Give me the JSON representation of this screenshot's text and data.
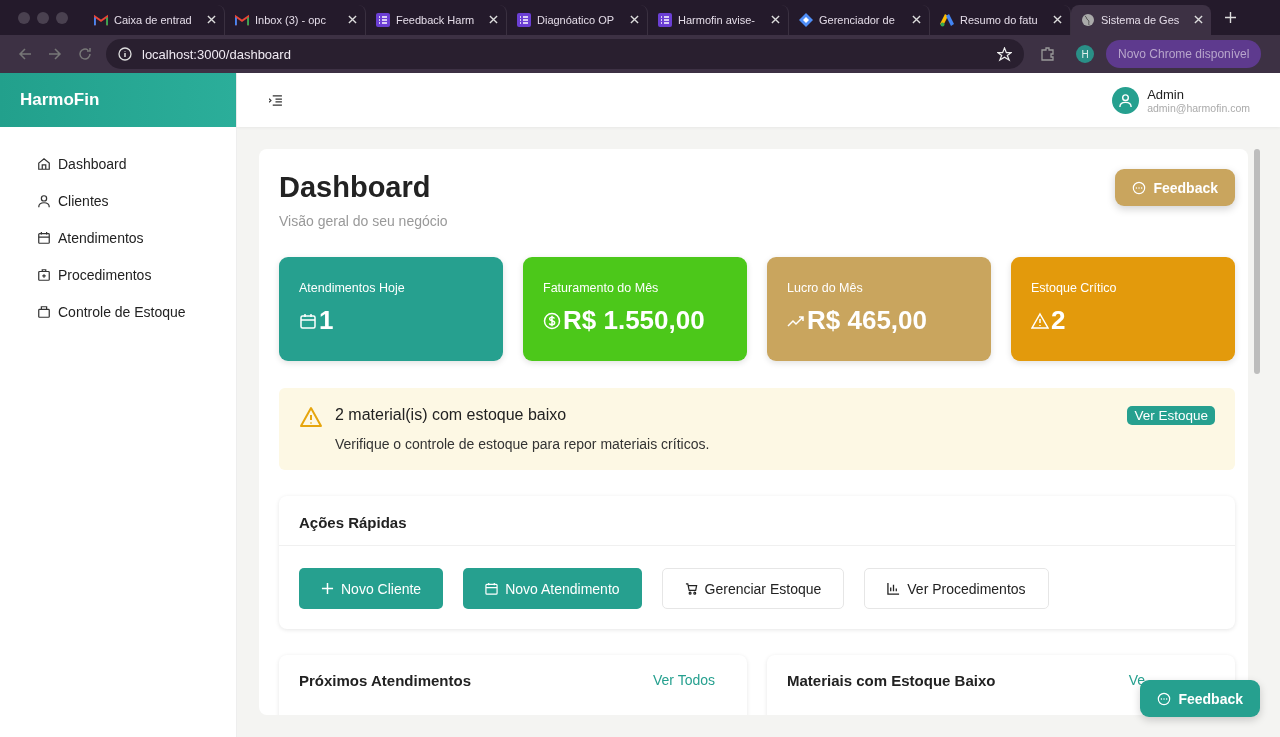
{
  "browser": {
    "tabs": [
      {
        "title": "Caixa de entrad",
        "kind": "mail",
        "selected": false
      },
      {
        "title": "Inbox (3) - opc",
        "kind": "mail",
        "selected": false
      },
      {
        "title": "Feedback Harm",
        "kind": "list",
        "selected": false
      },
      {
        "title": "Diagnóatico OP",
        "kind": "list",
        "selected": false
      },
      {
        "title": "Harmofin avise-",
        "kind": "list",
        "selected": false
      },
      {
        "title": "Gerenciador de",
        "kind": "diamond",
        "selected": false
      },
      {
        "title": "Resumo do fatu",
        "kind": "triangle",
        "selected": false
      },
      {
        "title": "Sistema de Ges",
        "kind": "globe",
        "selected": true
      }
    ],
    "url": "localhost:3000/dashboard",
    "profile": "H",
    "update_button": "Novo Chrome disponível"
  },
  "sidebar": {
    "brand": "HarmoFin",
    "items": [
      {
        "label": "Dashboard",
        "kind": "home"
      },
      {
        "label": "Clientes",
        "kind": "user"
      },
      {
        "label": "Atendimentos",
        "kind": "calendar"
      },
      {
        "label": "Procedimentos",
        "kind": "kit"
      },
      {
        "label": "Controle de Estoque",
        "kind": "bag"
      }
    ]
  },
  "header": {
    "user_name": "Admin",
    "user_email": "admin@harmofin.com"
  },
  "page": {
    "title": "Dashboard",
    "subtitle": "Visão geral do seu negócio",
    "feedback_button": "Feedback"
  },
  "stats": [
    {
      "label": "Atendimentos Hoje",
      "value": "1",
      "kind": "calendar",
      "color": "#26a08f"
    },
    {
      "label": "Faturamento do Mês",
      "value": "R$ 1.550,00",
      "kind": "dollar",
      "color": "#4cc81a"
    },
    {
      "label": "Lucro do Mês",
      "value": "R$ 465,00",
      "kind": "trend",
      "color": "#c9a55e"
    },
    {
      "label": "Estoque Crítico",
      "value": "2",
      "kind": "warning",
      "color": "#e39a0c"
    }
  ],
  "alert": {
    "title": "2 material(is) com estoque baixo",
    "message": "Verifique o controle de estoque para repor materiais críticos.",
    "action": "Ver Estoque"
  },
  "quick_actions": {
    "title": "Ações Rápidas",
    "buttons": [
      {
        "label": "Novo Cliente",
        "kind": "primary"
      },
      {
        "label": "Novo Atendimento",
        "kind": "primary"
      },
      {
        "label": "Gerenciar Estoque",
        "kind": "secondary"
      },
      {
        "label": "Ver Procedimentos",
        "kind": "secondary"
      }
    ]
  },
  "panels": [
    {
      "title": "Próximos Atendimentos",
      "link": "Ver Todos"
    },
    {
      "title": "Materiais com Estoque Baixo",
      "link": "Ve"
    }
  ],
  "floating_feedback": "Feedback"
}
